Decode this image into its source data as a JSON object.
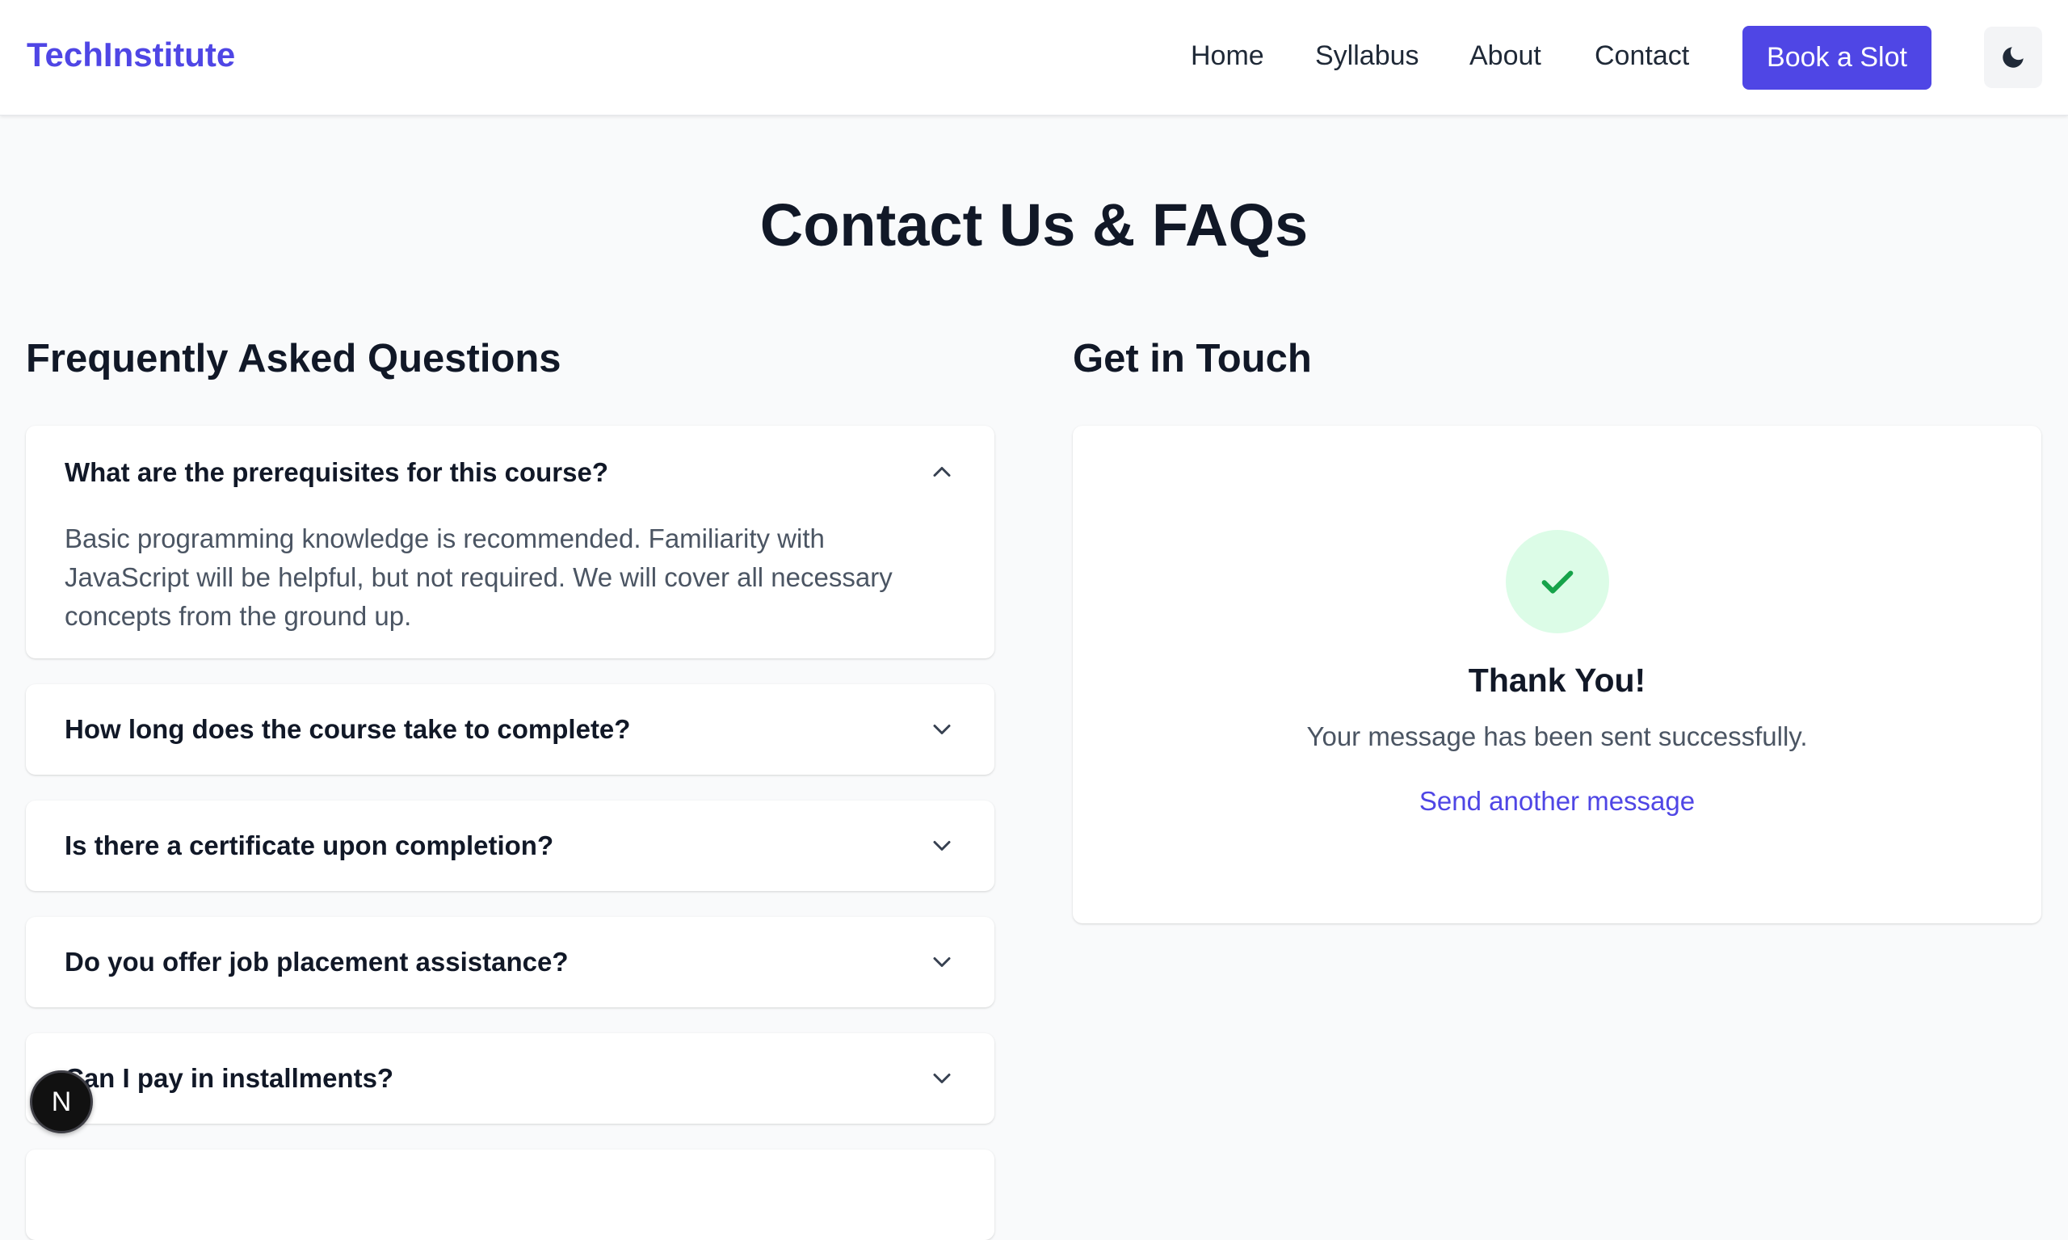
{
  "navbar": {
    "brand": "TechInstitute",
    "links": [
      "Home",
      "Syllabus",
      "About",
      "Contact"
    ],
    "cta_label": "Book a Slot",
    "theme_toggle_icon": "moon-icon"
  },
  "page": {
    "title": "Contact Us & FAQs"
  },
  "faq": {
    "heading": "Frequently Asked Questions",
    "items": [
      {
        "question": "What are the prerequisites for this course?",
        "answer": "Basic programming knowledge is recommended. Familiarity with JavaScript will be helpful, but not required. We will cover all necessary concepts from the ground up.",
        "expanded": true
      },
      {
        "question": "How long does the course take to complete?",
        "expanded": false
      },
      {
        "question": "Is there a certificate upon completion?",
        "expanded": false
      },
      {
        "question": "Do you offer job placement assistance?",
        "expanded": false
      },
      {
        "question": "Can I pay in installments?",
        "expanded": false
      }
    ]
  },
  "contact": {
    "heading": "Get in Touch",
    "success_icon": "check-icon",
    "success_title": "Thank You!",
    "success_message": "Your message has been sent successfully.",
    "send_another_label": "Send another message"
  },
  "dev_badge": {
    "label": "N"
  },
  "colors": {
    "accent": "#4f46e5",
    "success": "#16a34a",
    "success_bg": "#dcfce7",
    "page_bg": "#f9fafb"
  }
}
